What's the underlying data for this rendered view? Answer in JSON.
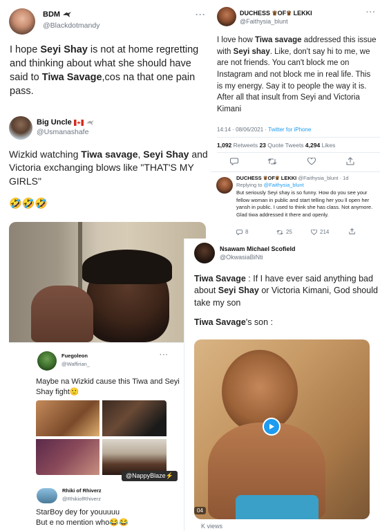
{
  "colors": {
    "twitter_blue": "#1d9bf0",
    "text_gray": "#6b7580",
    "play_button": "#1d9bf0",
    "label_bg": "#2c2c2c"
  },
  "tweet1": {
    "name": "BDM",
    "handle": "@Blackdotmandy",
    "text": [
      "I hope ",
      "Seyi Shay",
      " is not at home regretting and thinking about what she should have said to ",
      "Tiwa Savage",
      ",cos na that one pain pass."
    ],
    "more": "···"
  },
  "tweet2": {
    "name": "Big Uncle",
    "handle": "@Usmanashafe",
    "text": [
      "Wizkid watching ",
      "Tiwa savage",
      ", ",
      "Seyi Shay",
      " and Victoria exchanging blows like \"THAT'S MY GIRLS\""
    ],
    "emojis": "🤣🤣🤣"
  },
  "tweet3": {
    "name_parts": [
      "DUCHESS ",
      "OF",
      " LEKKI"
    ],
    "handle": "@Faithysia_blunt",
    "text": [
      "I love how ",
      "Tiwa savage",
      " addressed this issue with ",
      "Seyi shay",
      ". Like, don't say hi to me, we are not friends. You can't block me on Instagram and not block me in real life. This is my energy. Say it to people the way it is. After all that insult from Seyi and Victoria Kimani"
    ],
    "time": "14:14 · 08/06/2021 · ",
    "source": "Twitter for iPhone",
    "retweets_count": "1,092",
    "retweets_label": " Retweets ",
    "quotes_count": "23",
    "quotes_label": " Quote Tweets ",
    "likes_count": "4,294",
    "likes_label": " Likes",
    "more": "···"
  },
  "reply": {
    "name_parts": [
      "DUCHESS ",
      "OF",
      " LEKKI"
    ],
    "handle_time": "@Faithysia_blunt · 1d",
    "replying_prefix": "Replying to ",
    "replying_handle": "@Faithysia_blunt",
    "text": "But seriously Seyi shay is so funny. How do you see your fellow woman in public and start telling her you ll open her yansh in public. I used to think she has class. Not anymore. Glad tiwa addressed it there and openly.",
    "replies": "8",
    "retweets": "25",
    "likes": "214"
  },
  "tweet4": {
    "name": "Nsawam Michael Scofield",
    "handle": "@OkwasiaBiNti",
    "text": [
      "Tiwa Savage",
      " : If I have ever said anything bad about ",
      "Seyi Shay",
      " or Victoria Kimani, God should take my son"
    ],
    "text2": [
      "Tiwa Savage",
      "'s son :"
    ],
    "video_time": "04",
    "views": "K views"
  },
  "tweet5": {
    "name": "Fuegoleon",
    "handle": "@Waffirian_",
    "text": "Maybe na Wizkid cause this Tiwa and Seyi Shay fight🙂",
    "watermark": "@NappyBlaze⚡",
    "more": "···"
  },
  "tweet6": {
    "name": "Rhiki of Rhiverz",
    "handle": "@RhikiofRhiverz",
    "text_line1": "StarBoy dey for youuuuu",
    "text_line2": "But e no mention who😂😂"
  }
}
